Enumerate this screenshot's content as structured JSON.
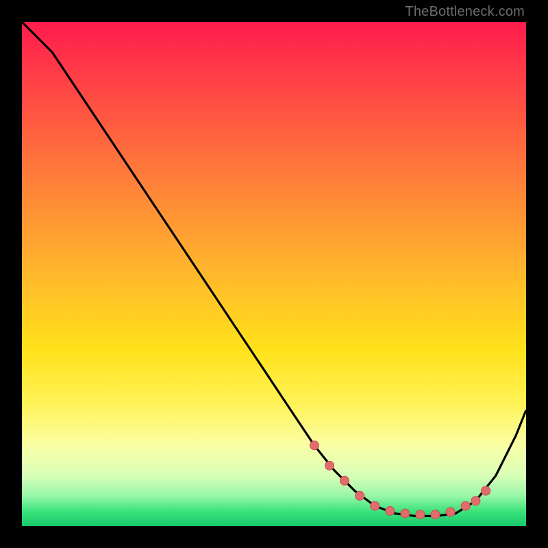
{
  "attribution": "TheBottleneck.com",
  "chart_data": {
    "type": "line",
    "title": "",
    "xlabel": "",
    "ylabel": "",
    "xlim": [
      0,
      100
    ],
    "ylim": [
      0,
      100
    ],
    "series": [
      {
        "name": "bottleneck-curve",
        "x": [
          0,
          6,
          12,
          18,
          24,
          30,
          36,
          42,
          48,
          54,
          58,
          62,
          66,
          70,
          74,
          78,
          82,
          86,
          90,
          94,
          98,
          100
        ],
        "y": [
          100,
          94,
          85,
          76,
          67,
          58,
          49,
          40,
          31,
          22,
          16,
          11,
          7,
          4,
          2.5,
          2,
          2,
          2.5,
          5,
          10,
          18,
          23
        ]
      }
    ],
    "markers": {
      "name": "highlighted-points",
      "color": "#e06c6c",
      "x": [
        58,
        61,
        64,
        67,
        70,
        73,
        76,
        79,
        82,
        85,
        88,
        90,
        92
      ],
      "y": [
        16,
        12,
        9,
        6,
        4,
        3,
        2.5,
        2.3,
        2.3,
        2.8,
        4,
        5,
        7
      ]
    },
    "gradient_stops": [
      {
        "pos": 0,
        "color": "#ff1c4c"
      },
      {
        "pos": 50,
        "color": "#ffb82c"
      },
      {
        "pos": 76,
        "color": "#fff35a"
      },
      {
        "pos": 97,
        "color": "#3de37c"
      },
      {
        "pos": 100,
        "color": "#18c96a"
      }
    ]
  }
}
